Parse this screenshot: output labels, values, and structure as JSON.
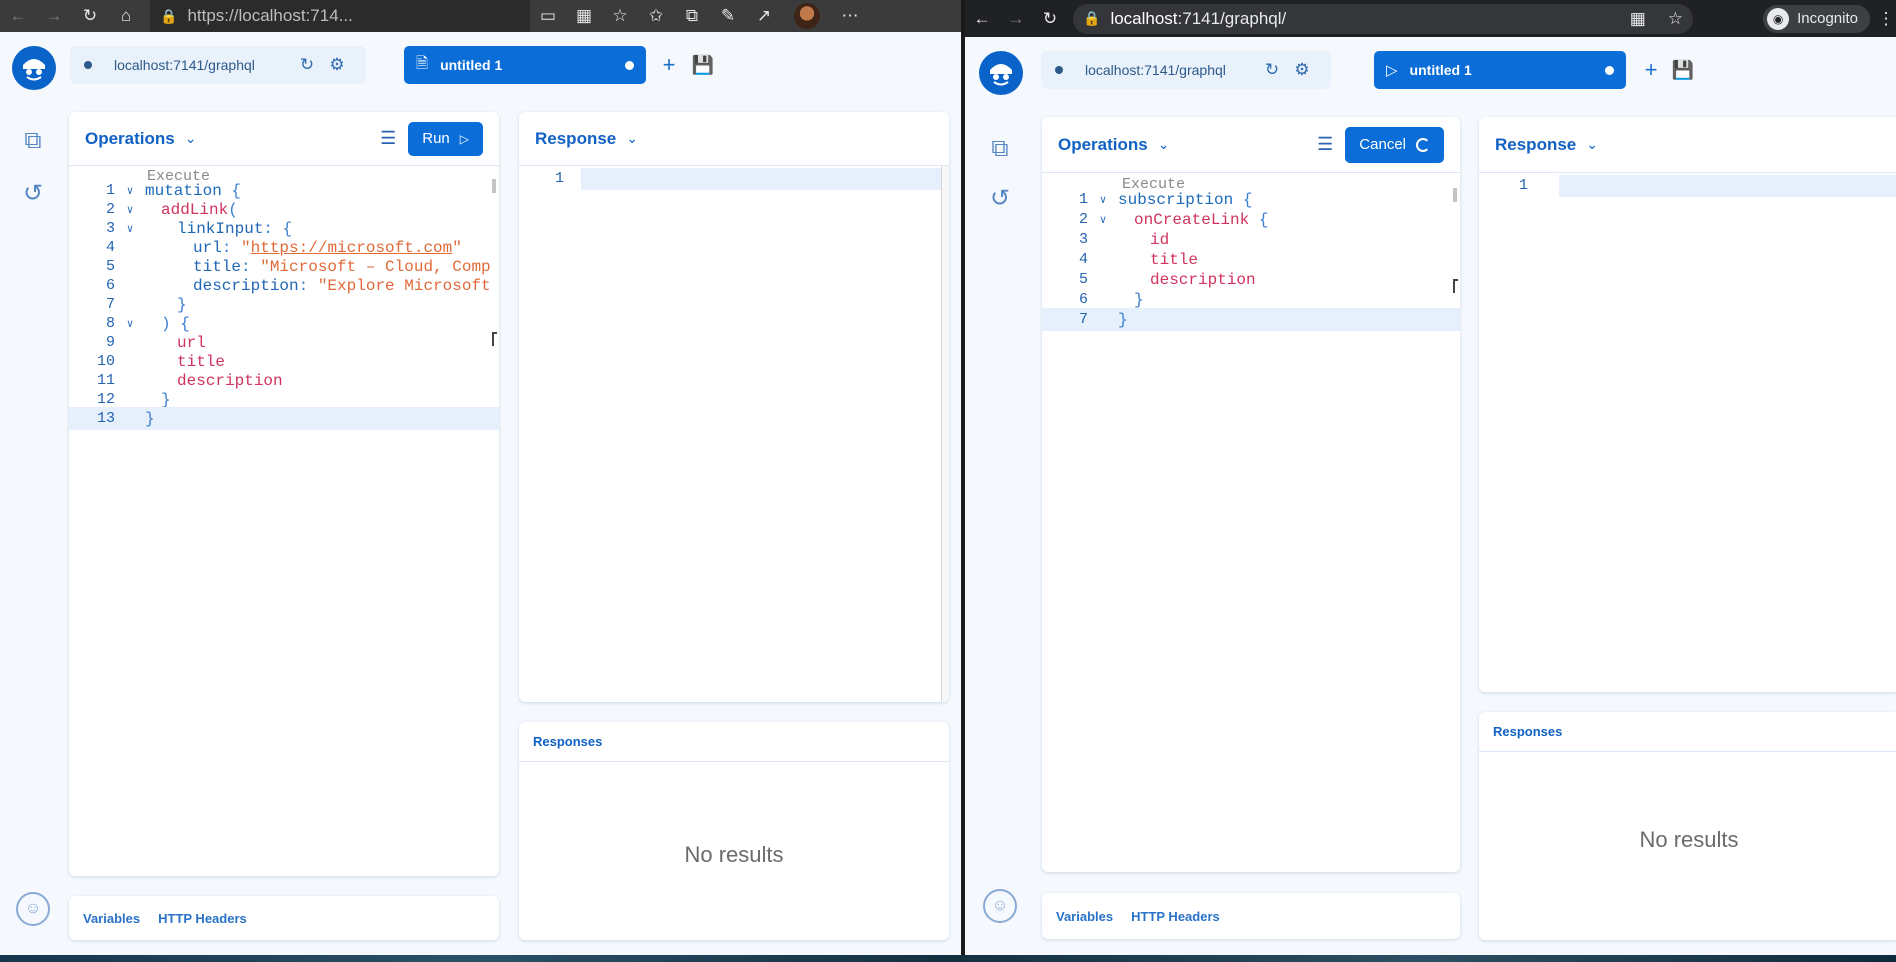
{
  "left": {
    "browser": {
      "url": "https://localhost:714...",
      "icons": [
        "back-arrow-icon",
        "forward-arrow-icon",
        "reload-icon",
        "home-icon",
        "lock-icon",
        "cast-icon",
        "apps-icon",
        "favorite-add-icon",
        "favorites-icon",
        "collections-icon",
        "edit-icon",
        "share-icon",
        "more-icon"
      ]
    },
    "app": {
      "endpoint": "localhost:7141/graphql",
      "tab_label": "untitled 1",
      "operations_label": "Operations",
      "run_label": "Run",
      "response_label": "Response",
      "responses_label": "Responses",
      "no_results": "No results",
      "variables_label": "Variables",
      "headers_label": "HTTP Headers",
      "exec_lens": "Execute",
      "response_line_number": "1",
      "code": [
        {
          "n": "1",
          "t": [
            [
              "kw",
              "mutation "
            ],
            [
              "pn",
              "{"
            ]
          ]
        },
        {
          "n": "2",
          "t": [
            [
              "fld",
              "addLink"
            ],
            [
              "pn",
              "("
            ]
          ]
        },
        {
          "n": "3",
          "t": [
            [
              "arg",
              "linkInput"
            ],
            [
              "pn",
              ": {"
            ]
          ]
        },
        {
          "n": "4",
          "t": [
            [
              "arg",
              "url"
            ],
            [
              "pn",
              ": "
            ],
            [
              "str",
              "\""
            ],
            [
              "strl",
              "https://microsoft.com"
            ],
            [
              "str",
              "\""
            ]
          ]
        },
        {
          "n": "5",
          "t": [
            [
              "arg",
              "title"
            ],
            [
              "pn",
              ": "
            ],
            [
              "str",
              "\"Microsoft – Cloud, Comp"
            ]
          ]
        },
        {
          "n": "6",
          "t": [
            [
              "arg",
              "description"
            ],
            [
              "pn",
              ": "
            ],
            [
              "str",
              "\"Explore Microsoft"
            ]
          ]
        },
        {
          "n": "7",
          "t": [
            [
              "pn",
              "}"
            ]
          ]
        },
        {
          "n": "8",
          "t": [
            [
              "pn",
              ") {"
            ]
          ]
        },
        {
          "n": "9",
          "t": [
            [
              "fld",
              "url"
            ]
          ]
        },
        {
          "n": "10",
          "t": [
            [
              "fld",
              "title"
            ]
          ]
        },
        {
          "n": "11",
          "t": [
            [
              "fld",
              "description"
            ]
          ]
        },
        {
          "n": "12",
          "t": [
            [
              "pn",
              "}"
            ]
          ]
        },
        {
          "n": "13",
          "t": [
            [
              "pn",
              "}"
            ]
          ]
        }
      ]
    }
  },
  "right": {
    "browser": {
      "url_host": "localhost",
      "url_path": ":7141/graphql/",
      "incognito_label": "Incognito",
      "icons": [
        "back-arrow-icon",
        "forward-arrow-icon",
        "reload-icon",
        "lock-icon",
        "apps-icon",
        "star-icon",
        "incognito-icon",
        "more-icon"
      ]
    },
    "app": {
      "endpoint": "localhost:7141/graphql",
      "tab_label": "untitled 1",
      "operations_label": "Operations",
      "cancel_label": "Cancel",
      "response_label": "Response",
      "responses_label": "Responses",
      "no_results": "No results",
      "variables_label": "Variables",
      "headers_label": "HTTP Headers",
      "exec_lens": "Execute",
      "response_line_number": "1",
      "code": [
        {
          "n": "1",
          "t": [
            [
              "kw",
              "subscription "
            ],
            [
              "pn",
              "{"
            ]
          ]
        },
        {
          "n": "2",
          "t": [
            [
              "fld",
              "onCreateLink "
            ],
            [
              "pn",
              "{"
            ]
          ]
        },
        {
          "n": "3",
          "t": [
            [
              "fld",
              "id"
            ]
          ]
        },
        {
          "n": "4",
          "t": [
            [
              "fld",
              "title"
            ]
          ]
        },
        {
          "n": "5",
          "t": [
            [
              "fld",
              "description"
            ]
          ]
        },
        {
          "n": "6",
          "t": [
            [
              "pn",
              "}"
            ]
          ]
        },
        {
          "n": "7",
          "t": [
            [
              "pn",
              "}"
            ]
          ]
        }
      ]
    }
  }
}
